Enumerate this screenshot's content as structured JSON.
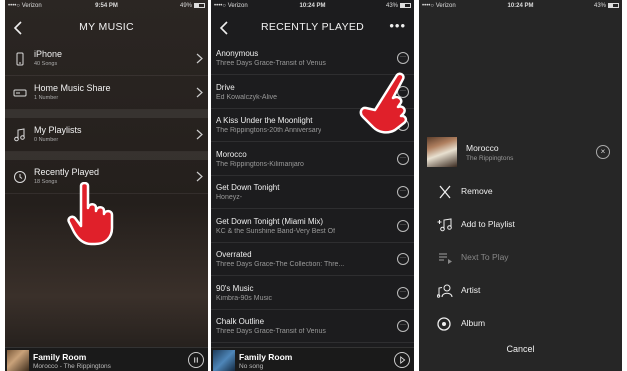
{
  "colors": {
    "hand_red": "#e0202a",
    "hand_outline": "#ffffff",
    "list_bg": "#1c1c1e"
  },
  "screens": [
    {
      "status": {
        "carrier": "••••○ Verizon",
        "time": "9:54 PM",
        "battery": "49%"
      },
      "nav": {
        "title": "MY MUSIC",
        "left_icon": "back-chevron-icon"
      },
      "rows": [
        {
          "icon": "phone-icon",
          "name": "iPhone",
          "sub": "40 Songs"
        },
        {
          "icon": "media-server-icon",
          "name": "Home Music Share",
          "sub": "1 Number"
        },
        {
          "icon": "playlist-icon",
          "name": "My Playlists",
          "sub": "0 Number"
        },
        {
          "icon": "recent-clock-icon",
          "name": "Recently Played",
          "sub": "18 Songs"
        }
      ],
      "player": {
        "title": "Family Room",
        "sub": "Morocco - The Rippingtons",
        "control": "pause-icon"
      }
    },
    {
      "status": {
        "carrier": "••••○ Verizon",
        "time": "10:24 PM",
        "battery": "43%"
      },
      "nav": {
        "title": "RECENTLY PLAYED",
        "left_icon": "back-chevron-icon",
        "right_icon": "more-dots-icon",
        "right_text": "•••"
      },
      "tracks": [
        {
          "name": "Anonymous",
          "sub": "Three Days Grace-Transit of Venus"
        },
        {
          "name": "Drive",
          "sub": "Ed Kowalczyk-Alive"
        },
        {
          "name": "A Kiss Under the Moonlight",
          "sub": "The Rippingtons-20th Anniversary"
        },
        {
          "name": "Morocco",
          "sub": "The Rippingtons-Kilimanjaro"
        },
        {
          "name": "Get Down Tonight",
          "sub": "Honeyz-"
        },
        {
          "name": "Get Down Tonight (Miami Mix)",
          "sub": "KC & the Sunshine Band-Very Best Of"
        },
        {
          "name": "Overrated",
          "sub": "Three Days Grace-The Collection: Thre..."
        },
        {
          "name": "90's Music",
          "sub": "Kimbra-90s Music"
        },
        {
          "name": "Chalk Outline",
          "sub": "Three Days Grace-Transit of Venus"
        }
      ],
      "track_more": "···",
      "player": {
        "title": "Family Room",
        "sub": "No song",
        "control": "play-icon"
      }
    },
    {
      "status": {
        "carrier": "••••○ Verizon",
        "time": "10:24 PM",
        "battery": "43%"
      },
      "sheet": {
        "song": "Morocco",
        "artist": "The Rippingtons",
        "close": "×",
        "actions": [
          {
            "icon": "remove-x-icon",
            "label": "Remove",
            "enabled": true
          },
          {
            "icon": "add-to-playlist-icon",
            "label": "Add to Playlist",
            "enabled": true
          },
          {
            "icon": "next-to-play-icon",
            "label": "Next To Play",
            "enabled": false
          },
          {
            "icon": "artist-icon",
            "label": "Artist",
            "enabled": true
          },
          {
            "icon": "album-icon",
            "label": "Album",
            "enabled": true
          }
        ],
        "cancel": "Cancel"
      }
    }
  ]
}
